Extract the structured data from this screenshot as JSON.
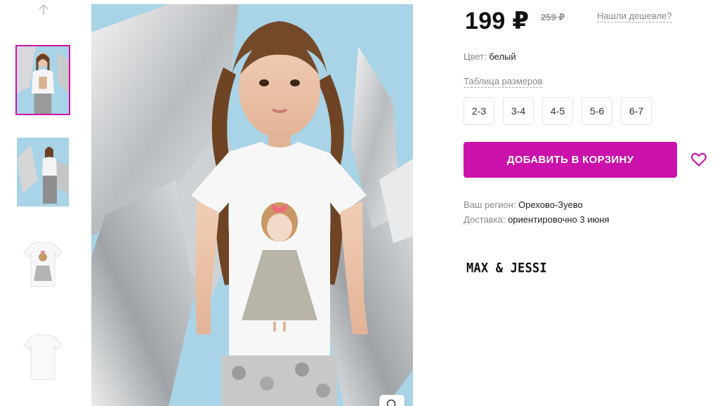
{
  "gallery": {
    "arrow_icon": "arrow-up-icon",
    "thumbnails": [
      {
        "label": "photo-1",
        "active": true
      },
      {
        "label": "photo-2",
        "active": false
      },
      {
        "label": "photo-3",
        "active": false
      },
      {
        "label": "photo-4",
        "active": false
      }
    ],
    "zoom_icon": "zoom-icon"
  },
  "product": {
    "price": "199 ₽",
    "old_price": "259 ₽",
    "cheaper_link": "Нашли дешевле?",
    "color_label": "Цвет:",
    "color_value": "белый",
    "size_table_link": "Таблица размеров",
    "sizes": [
      "2-3",
      "3-4",
      "4-5",
      "5-6",
      "6-7"
    ],
    "add_to_cart": "ДОБАВИТЬ В КОРЗИНУ",
    "favorite_icon": "heart-icon",
    "region_label": "Ваш регион:",
    "region_value": "Орехово-Зуево",
    "delivery_label": "Доставка:",
    "delivery_value": "ориентировочно 3 июня",
    "brand": "MAX & JESSI"
  },
  "colors": {
    "accent": "#cb11ab",
    "price": "#111111",
    "muted": "#888888",
    "photo_background": "#a9d3e6"
  }
}
